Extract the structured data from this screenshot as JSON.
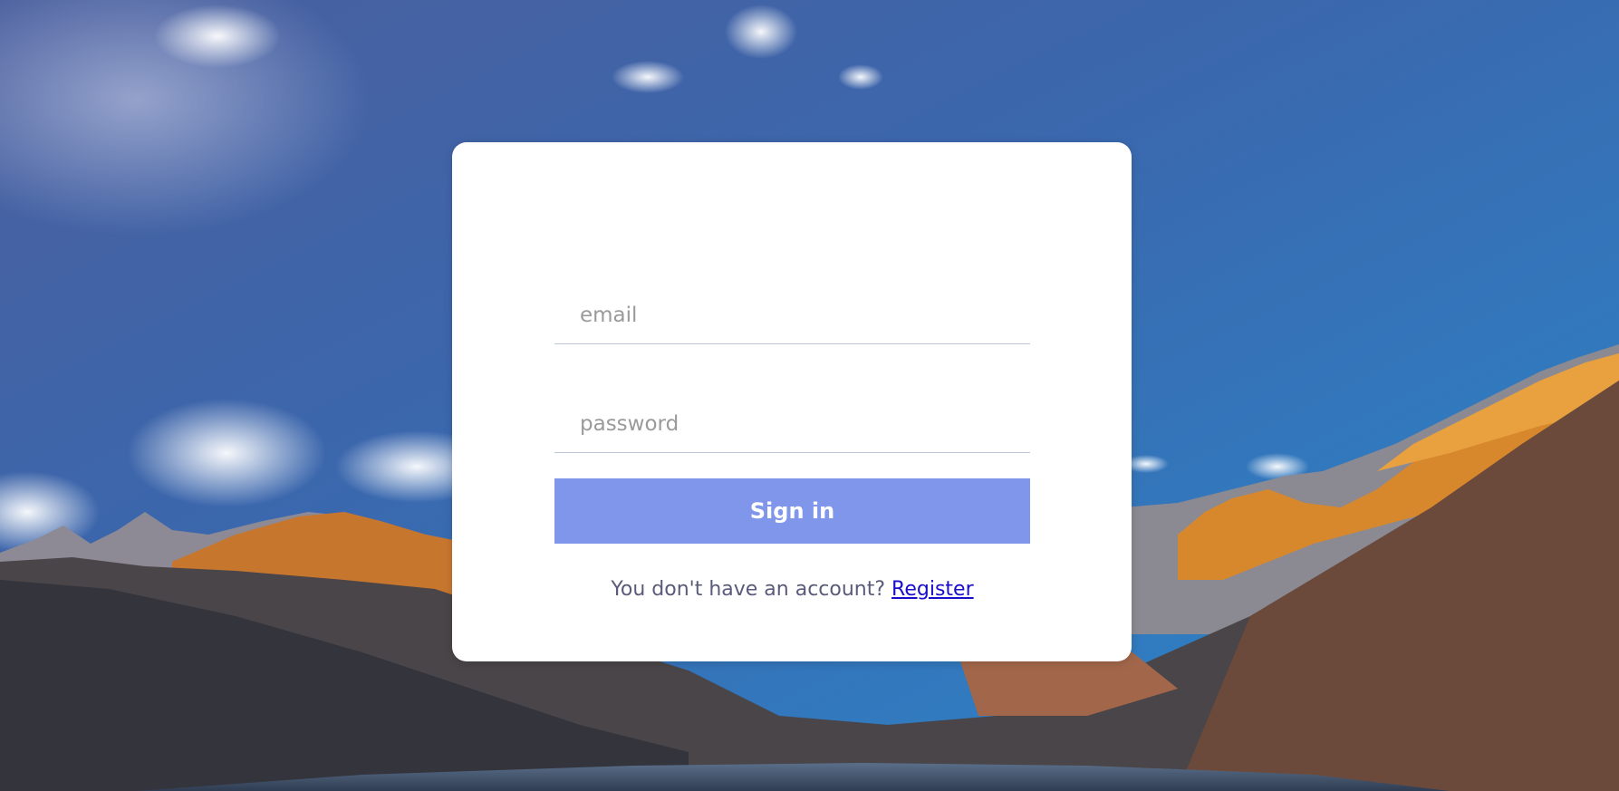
{
  "login": {
    "email_placeholder": "email",
    "password_placeholder": "password",
    "signin_label": "Sign in",
    "register_prompt": "You don't have an account?",
    "register_link": "Register"
  },
  "theme": {
    "button_color": "#7f96ea",
    "link_color": "#1a0dcc",
    "sky_top": "#3a5aa0",
    "sky_bottom": "#2e7ec4"
  },
  "background": {
    "icon": "mountain-landscape-photo"
  }
}
